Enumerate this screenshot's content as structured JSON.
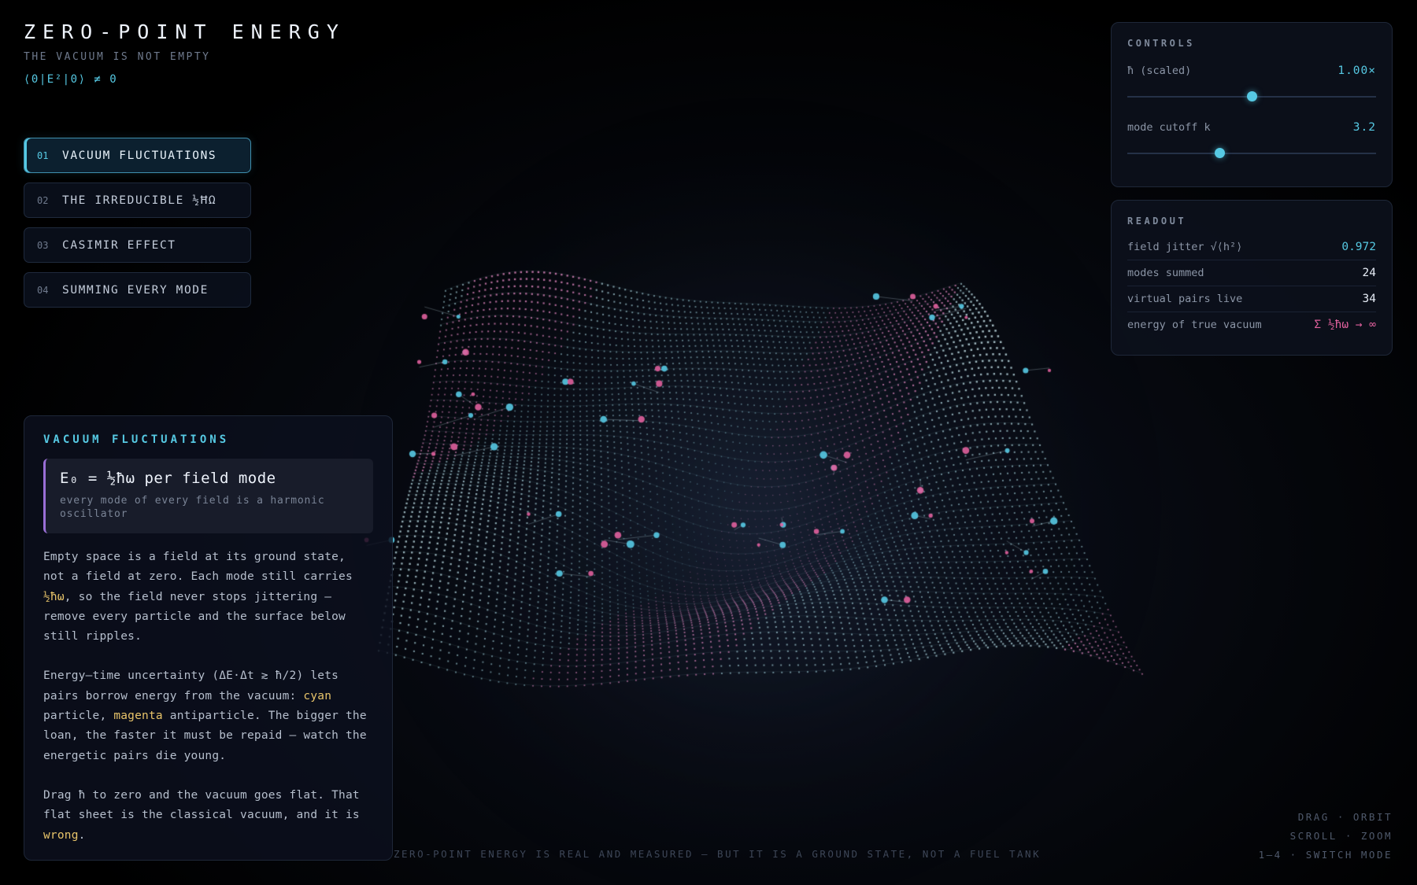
{
  "header": {
    "title": "ZERO-POINT ENERGY",
    "subtitle": "THE VACUUM IS NOT EMPTY",
    "formula": "⟨0|E²|0⟩ ≠ 0"
  },
  "modes": [
    {
      "num": "01",
      "label": "VACUUM FLUCTUATIONS",
      "active": true
    },
    {
      "num": "02",
      "label": "THE IRREDUCIBLE ½ĦΩ",
      "active": false
    },
    {
      "num": "03",
      "label": "CASIMIR EFFECT",
      "active": false
    },
    {
      "num": "04",
      "label": "SUMMING EVERY MODE",
      "active": false
    }
  ],
  "info": {
    "title": "VACUUM FLUCTUATIONS",
    "equation": "E₀ = ½ħω per field mode",
    "equation_note": "every mode of every field is a harmonic oscillator",
    "p1_a": "Empty space is a field at its ground state, not a field at zero. Each mode still carries ",
    "p1_hl": "½ħω",
    "p1_b": ", so the field never stops jittering — remove every particle and the surface below still ripples.",
    "p2_a": "Energy–time uncertainty (ΔE·Δt ≳ ħ/2) lets pairs borrow energy from the vacuum: ",
    "p2_hl1": "cyan",
    "p2_b": " particle, ",
    "p2_hl2": "magenta",
    "p2_c": " antiparticle. The bigger the loan, the faster it must be repaid — watch the energetic pairs die young.",
    "p3_a": "Drag ħ to zero and the vacuum goes flat. That flat sheet is the classical vacuum, and it is ",
    "p3_hl": "wrong",
    "p3_b": "."
  },
  "controls": {
    "title": "CONTROLS",
    "hbar_label": "ħ (scaled)",
    "hbar_value": "1.00×",
    "hbar_level": 0.5,
    "cutoff_label": "mode cutoff k",
    "cutoff_value": "3.2",
    "cutoff_level": 0.37
  },
  "readout": {
    "title": "READOUT",
    "rows": [
      {
        "label": "field jitter √⟨h²⟩",
        "value": "0.972"
      },
      {
        "label": "modes summed",
        "value": "24"
      },
      {
        "label": "virtual pairs live",
        "value": "34"
      },
      {
        "label": "energy of true vacuum",
        "value": "Σ ½ħω → ∞"
      }
    ]
  },
  "hints": {
    "line1": "DRAG · ORBIT",
    "line2": "SCROLL · ZOOM",
    "line3": "1–4 · SWITCH MODE"
  },
  "footer": "ZERO-POINT ENERGY IS REAL AND MEASURED — BUT IT IS A GROUND STATE, NOT A FUEL TANK",
  "colors": {
    "accent_cyan": "#56c9e3",
    "accent_magenta": "#e0619d",
    "highlight_yellow": "#e8c46a",
    "background": "#000000"
  }
}
